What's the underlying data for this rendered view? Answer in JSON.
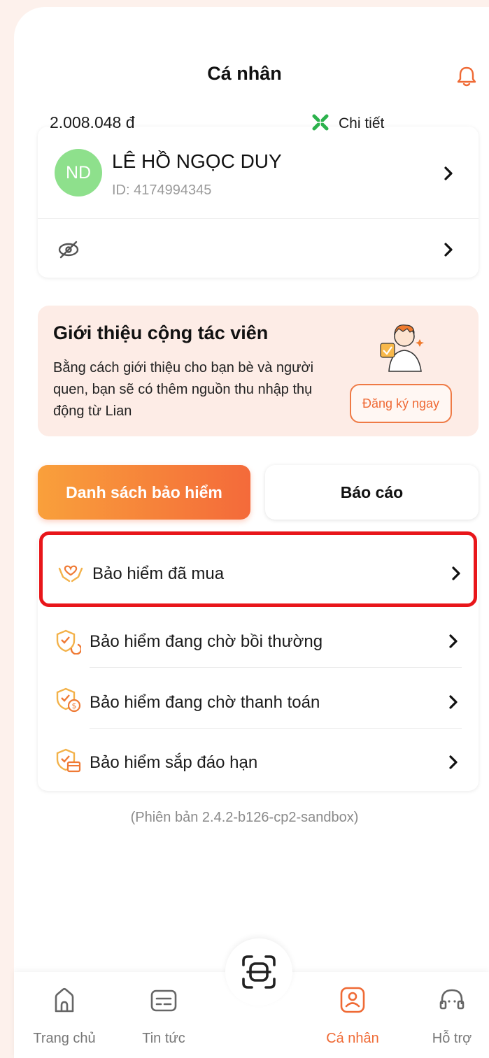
{
  "header": {
    "title": "Cá nhân"
  },
  "profile": {
    "avatar_initials": "ND",
    "name": "LÊ HỒ NGỌC DUY",
    "id_text": "ID: 4174994345",
    "balance": "2.008.048 đ",
    "detail_label": "Chi tiết"
  },
  "promo": {
    "title": "Giới thiệu cộng tác viên",
    "text": "Bằng cách giới thiệu cho bạn bè và người quen, bạn sẽ có thêm nguồn thu nhập thụ động từ Lian",
    "button_label": "Đăng ký ngay"
  },
  "tabs": [
    {
      "label": "Danh sách bảo hiểm",
      "active": true
    },
    {
      "label": "Báo cáo",
      "active": false
    }
  ],
  "insurance_list": [
    {
      "label": "Bảo hiểm đã mua",
      "icon": "hands-heart-icon"
    },
    {
      "label": "Bảo hiểm đang chờ bồi thường",
      "icon": "shield-refresh-icon"
    },
    {
      "label": "Bảo hiểm đang chờ thanh toán",
      "icon": "shield-dollar-icon"
    },
    {
      "label": "Bảo hiểm sắp đáo hạn",
      "icon": "shield-calendar-icon"
    }
  ],
  "version": "(Phiên bản 2.4.2-b126-cp2-sandbox)",
  "bottom_nav": [
    {
      "label": "Trang chủ",
      "icon": "home-icon",
      "active": false
    },
    {
      "label": "Tin tức",
      "icon": "news-icon",
      "active": false
    },
    {
      "label": "Cá nhân",
      "icon": "profile-icon",
      "active": true
    },
    {
      "label": "Hỗ trợ",
      "icon": "support-icon",
      "active": false
    }
  ],
  "colors": {
    "accent": "#ef6a35",
    "highlight": "#e8161a",
    "avatar": "#8ee08c",
    "detail_icon": "#2bb24c"
  }
}
